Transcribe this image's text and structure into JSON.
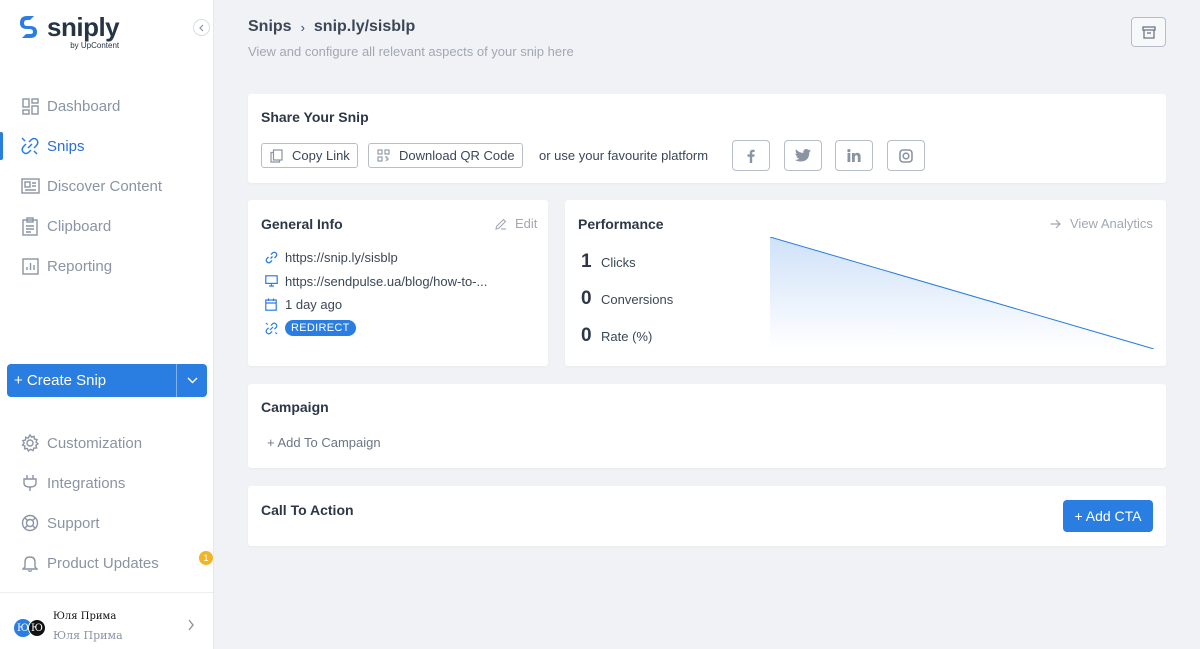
{
  "brand": {
    "name": "sniply",
    "sub": "by UpContent"
  },
  "nav": [
    {
      "label": "Dashboard",
      "icon": "dashboard-icon"
    },
    {
      "label": "Snips",
      "icon": "snips-icon",
      "active": true
    },
    {
      "label": "Discover Content",
      "icon": "discover-icon"
    },
    {
      "label": "Clipboard",
      "icon": "clipboard-icon"
    },
    {
      "label": "Reporting",
      "icon": "reporting-icon"
    }
  ],
  "create_snip": {
    "label": "+ Create Snip"
  },
  "nav_bottom": [
    {
      "label": "Customization",
      "icon": "gear-icon"
    },
    {
      "label": "Integrations",
      "icon": "plug-icon"
    },
    {
      "label": "Support",
      "icon": "lifebuoy-icon"
    },
    {
      "label": "Product Updates",
      "icon": "bell-icon",
      "badge": "1"
    }
  ],
  "user": {
    "initial": "Ю",
    "name": "Юля Прима",
    "sub": "Юля Прима"
  },
  "header": {
    "crumb_root": "Snips",
    "crumb_current": "snip.ly/sisblp",
    "subtitle": "View and configure all relevant aspects of your snip here"
  },
  "share": {
    "title": "Share Your Snip",
    "copy_link": "Copy Link",
    "download_qr": "Download QR Code",
    "platform_text": "or use your favourite platform",
    "platforms": [
      "facebook-icon",
      "twitter-icon",
      "linkedin-icon",
      "instagram-icon"
    ]
  },
  "general": {
    "title": "General Info",
    "edit": "Edit",
    "snip_url": "https://snip.ly/sisblp",
    "target_url": "https://sendpulse.ua/blog/how-to-...",
    "created": "1 day ago",
    "type": "REDIRECT"
  },
  "performance": {
    "title": "Performance",
    "view_analytics": "View Analytics",
    "stats": [
      {
        "value": "1",
        "label": "Clicks"
      },
      {
        "value": "0",
        "label": "Conversions"
      },
      {
        "value": "0",
        "label": "Rate (%)"
      }
    ]
  },
  "chart_data": {
    "type": "area",
    "x": [
      0,
      1
    ],
    "values": [
      1,
      0
    ],
    "title": "",
    "xlabel": "",
    "ylabel": "",
    "color": "#2a7de1"
  },
  "campaign": {
    "title": "Campaign",
    "add": "+ Add To Campaign"
  },
  "cta": {
    "title": "Call To Action",
    "add": "+ Add CTA"
  },
  "colors": {
    "accent": "#2a7de1",
    "badge": "#f0b429"
  }
}
